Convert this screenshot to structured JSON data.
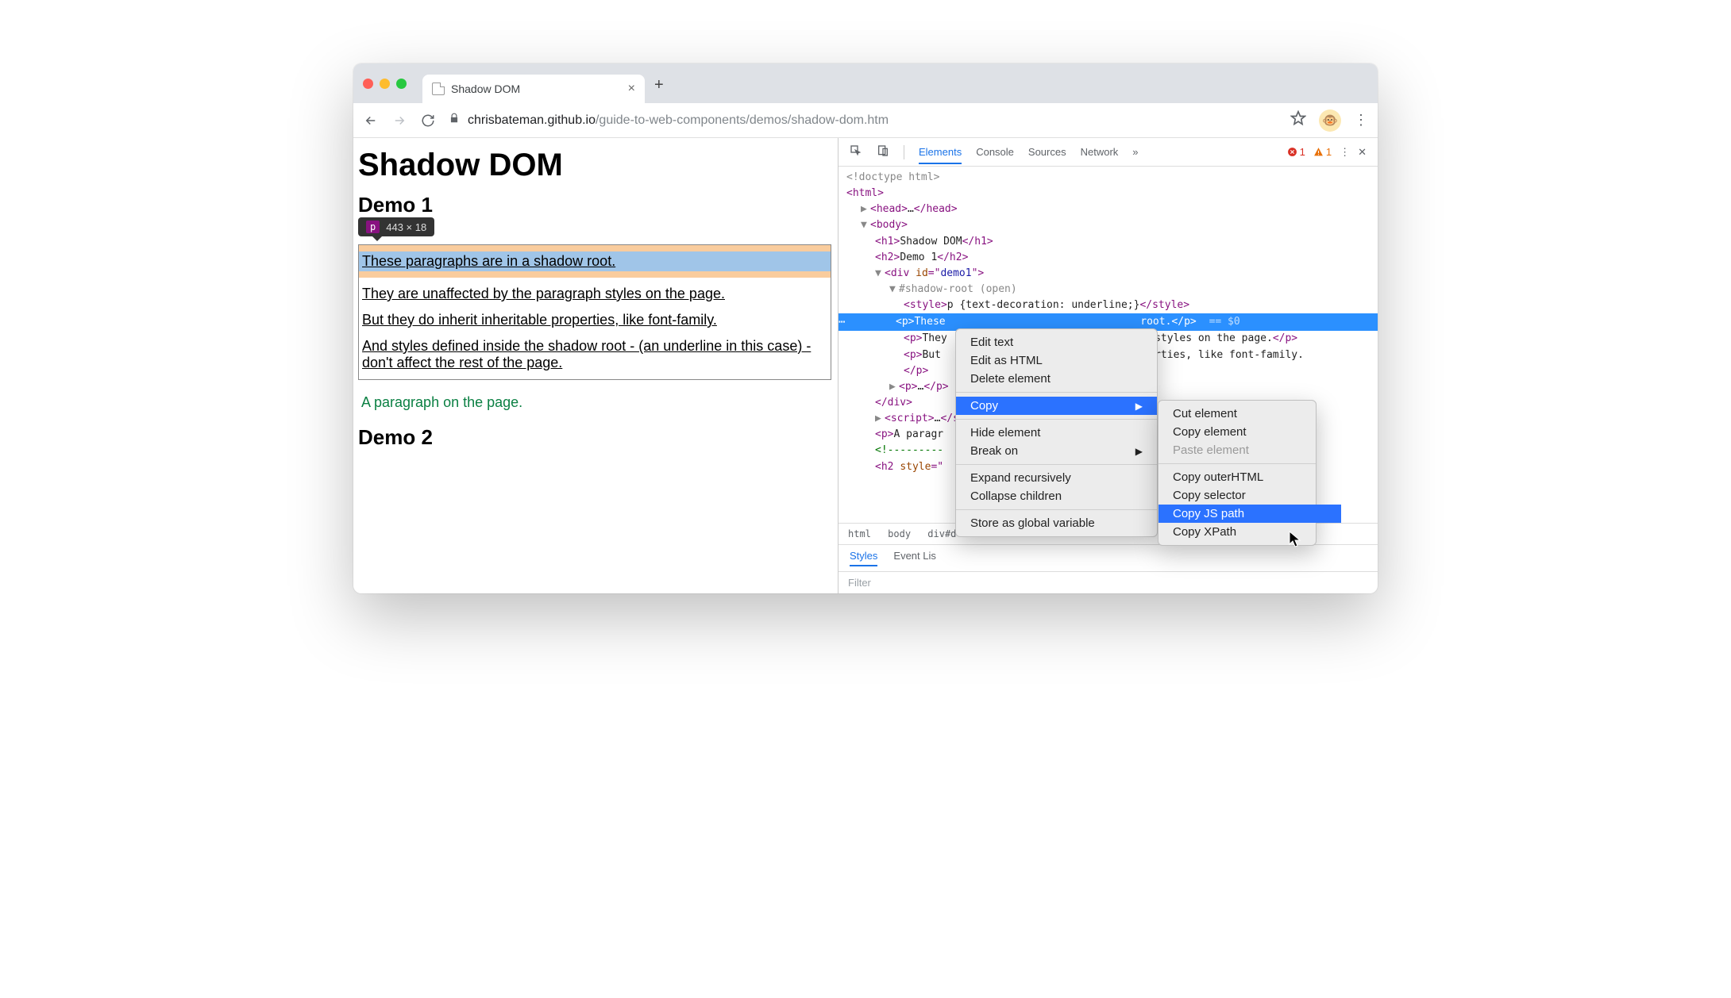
{
  "tab": {
    "title": "Shadow DOM"
  },
  "url": {
    "host": "chrisbateman.github.io",
    "path": "/guide-to-web-components/demos/shadow-dom.htm"
  },
  "page": {
    "h1": "Shadow DOM",
    "demo1": "Demo 1",
    "tooltip_tag": "p",
    "tooltip_size": "443 × 18",
    "p1": "These paragraphs are in a shadow root.",
    "p2": "They are unaffected by the paragraph styles on the page.",
    "p3": "But they do inherit inheritable properties, like font-family.",
    "p4": "And styles defined inside the shadow root - (an underline in this case) - don't affect the rest of the page.",
    "green": "A paragraph on the page.",
    "demo2": "Demo 2"
  },
  "devtools": {
    "tabs": {
      "elements": "Elements",
      "console": "Console",
      "sources": "Sources",
      "network": "Network"
    },
    "errors": "1",
    "warnings": "1",
    "dom": {
      "doctype": "<!doctype html>",
      "html_open": "<html>",
      "head": "<head>…</head>",
      "body_open": "<body>",
      "h1": "<h1>Shadow DOM</h1>",
      "h2": "<h2>Demo 1</h2>",
      "div_open_pre": "<div id=\"",
      "div_id": "demo1",
      "div_open_post": "\">",
      "shadow": "#shadow-root (open)",
      "style_line": "<style>p {text-decoration: underline;}</style>",
      "sel_p_open": "<p>",
      "sel_p_text_a": "These",
      "sel_p_text_b": "root.",
      "sel_p_close": "</p>",
      "sel_marker": "== $0",
      "p2a": "<p>They",
      "p2b": "aph styles on the page.</p>",
      "p3a": "<p>But ",
      "p3b": "roperties, like font-family.",
      "p_close": "</p>",
      "p_ell": "<p>…</p>",
      "div_close": "</div>",
      "script": "<script>…</scr",
      "pgreen": "<p>A paragr",
      "comment": "<!-------",
      "h2style": "<h2 style=\""
    },
    "breadcrumb": {
      "a": "html",
      "b": "body",
      "c": "div#d"
    },
    "styles_tabs": {
      "styles": "Styles",
      "events": "Event Lis"
    },
    "filter": "Filter"
  },
  "ctx1": {
    "edit_text": "Edit text",
    "edit_html": "Edit as HTML",
    "delete": "Delete element",
    "copy": "Copy",
    "hide": "Hide element",
    "break": "Break on",
    "expand": "Expand recursively",
    "collapse": "Collapse children",
    "store": "Store as global variable"
  },
  "ctx2": {
    "cut": "Cut element",
    "copyel": "Copy element",
    "paste": "Paste element",
    "outer": "Copy outerHTML",
    "selector": "Copy selector",
    "jspath": "Copy JS path",
    "xpath": "Copy XPath"
  }
}
